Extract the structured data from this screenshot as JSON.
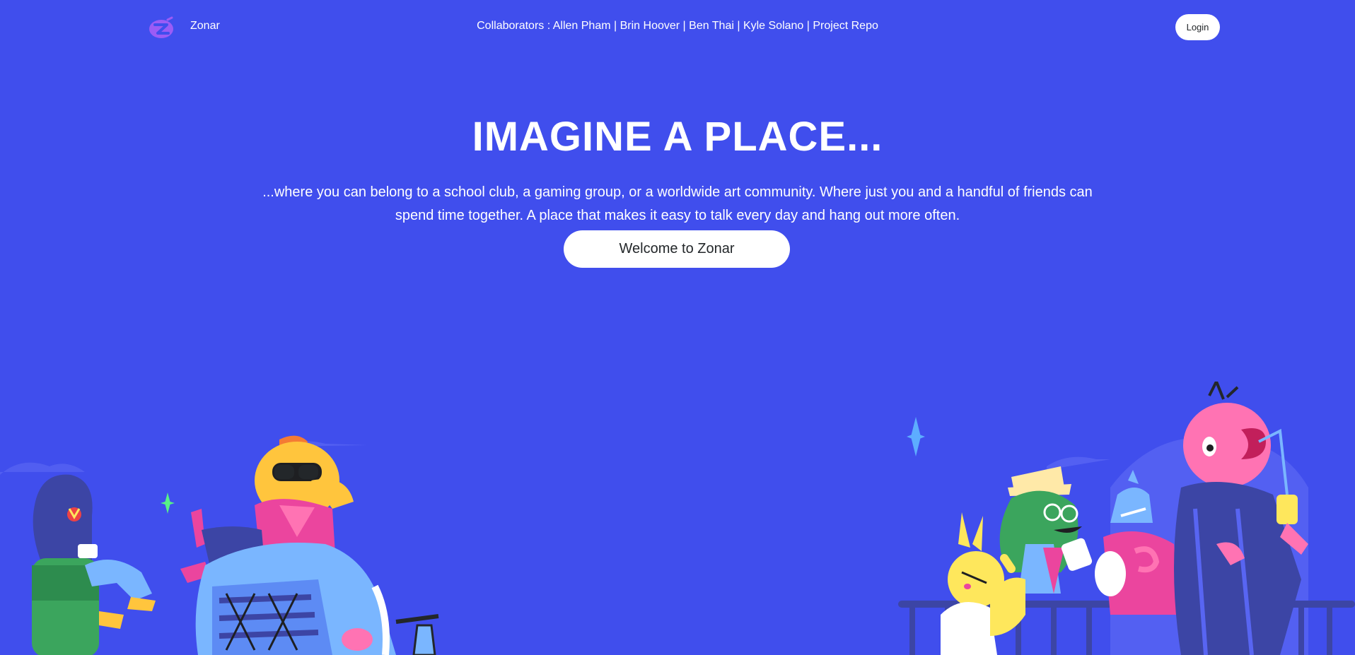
{
  "nav": {
    "brand": "Zonar",
    "logo_icon": "zonar-logo-icon",
    "collaborators_prefix": "Collaborators : ",
    "links": [
      "Allen Pham",
      "Brin Hoover",
      "Ben Thai",
      "Kyle Solano",
      "Project Repo"
    ],
    "separator": " | ",
    "login_label": "Login"
  },
  "hero": {
    "title": "IMAGINE A PLACE...",
    "description": "...where you can belong to a school club, a gaming group, or a worldwide art community. Where just you and a handful of friends can spend time together. A place that makes it easy to talk every day and hang out more often.",
    "cta_label": "Welcome to Zonar"
  },
  "illustrations": {
    "left": "friends-lounging-illustration",
    "right": "friends-hanging-out-illustration"
  },
  "colors": {
    "background": "#404EED",
    "button_bg": "#FFFFFF",
    "button_text": "#23272A",
    "logo": "#9B5CF6"
  }
}
